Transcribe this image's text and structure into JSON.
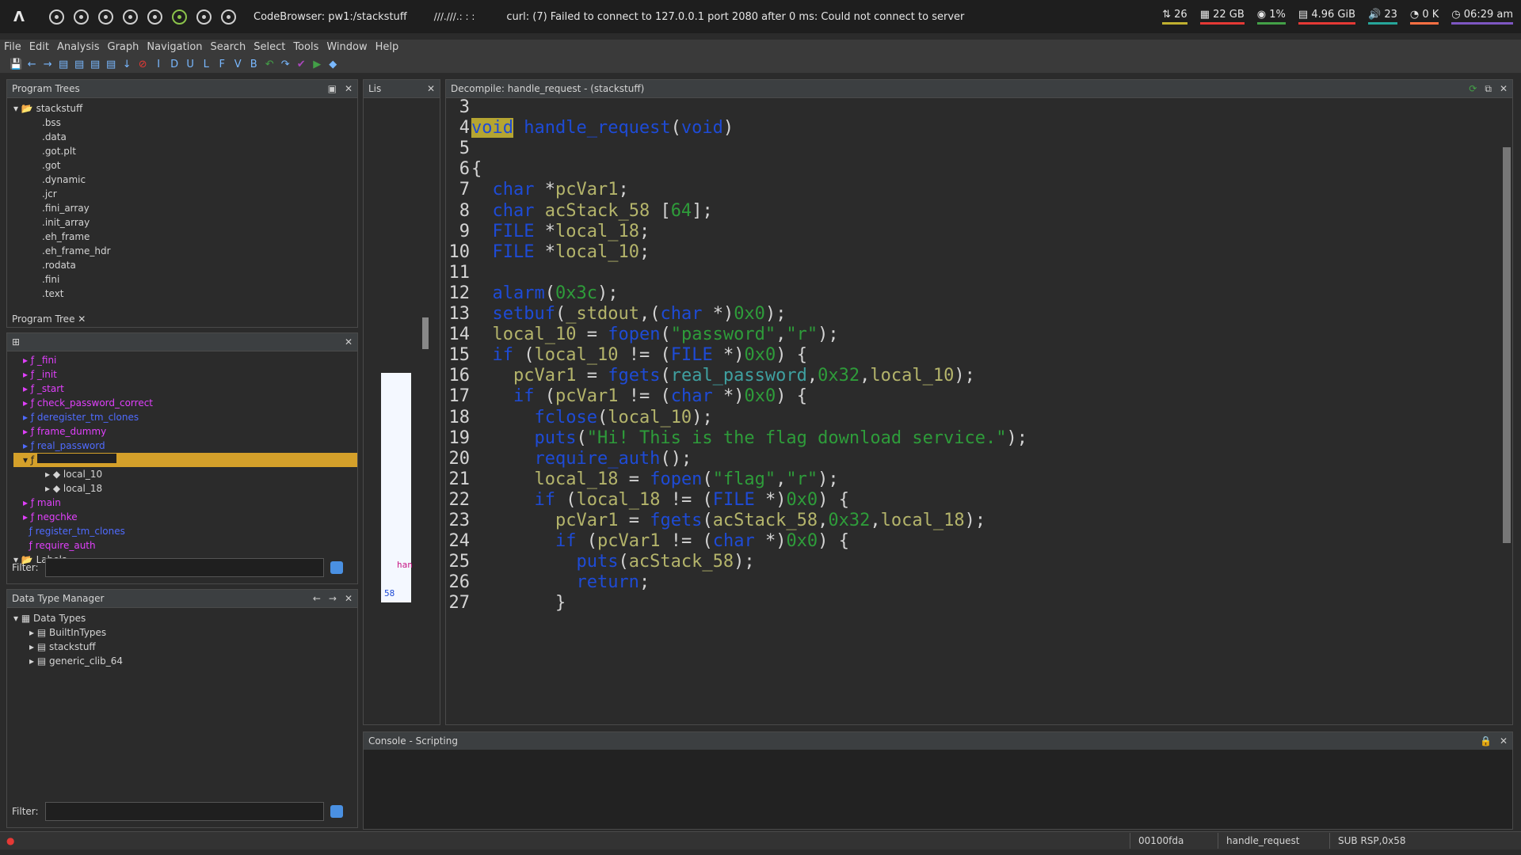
{
  "sysbar": {
    "window_title": "CodeBrowser: pw1:/stackstuff",
    "mid": "///.///.:  : :",
    "message": "curl: (7) Failed to connect to 127.0.0.1 port 2080 after 0 ms: Could not connect to server",
    "stats": [
      "⇅ 26",
      "▦ 22 GB",
      "◉ 1%",
      "▤ 4.96 GiB",
      "🔊 23",
      "◔ 0 K",
      "◷ 06:29 am"
    ]
  },
  "menu": [
    "File",
    "Edit",
    "Analysis",
    "Graph",
    "Navigation",
    "Search",
    "Select",
    "Tools",
    "Window",
    "Help"
  ],
  "program_trees": {
    "title": "Program Trees",
    "root": "stackstuff",
    "items": [
      ".bss",
      ".data",
      ".got.plt",
      ".got",
      ".dynamic",
      ".jcr",
      ".fini_array",
      ".init_array",
      ".eh_frame",
      ".eh_frame_hdr",
      ".rodata",
      ".fini",
      ".text"
    ],
    "tab": "Program Tree"
  },
  "symbol_tree": {
    "functions": [
      "_fini",
      "_init",
      "_start",
      "check_password_correct",
      "deregister_tm_clones",
      "frame_dummy",
      "real_password"
    ],
    "locals": [
      "local_10",
      "local_18"
    ],
    "functions2": [
      "main",
      "negchke",
      "register_tm_clones",
      "require_auth"
    ],
    "labels": "Labels",
    "filter_label": "Filter:"
  },
  "data_type_manager": {
    "title": "Data Type Manager",
    "root": "Data Types",
    "items": [
      "BuiltInTypes",
      "stackstuff",
      "generic_clib_64"
    ],
    "filter_label": "Filter:"
  },
  "listing": {
    "title": "Lis",
    "address": "58",
    "fragment": "han"
  },
  "decompile": {
    "title": "Decompile: handle_request -  (stackstuff)",
    "lines": [
      {
        "n": "3",
        "code": ""
      },
      {
        "n": "4",
        "code": "void handle_request(void)"
      },
      {
        "n": "5",
        "code": ""
      },
      {
        "n": "6",
        "code": "{"
      },
      {
        "n": "7",
        "code": "  char *pcVar1;"
      },
      {
        "n": "8",
        "code": "  char acStack_58 [64];"
      },
      {
        "n": "9",
        "code": "  FILE *local_18;"
      },
      {
        "n": "10",
        "code": "  FILE *local_10;"
      },
      {
        "n": "11",
        "code": ""
      },
      {
        "n": "12",
        "code": "  alarm(0x3c);"
      },
      {
        "n": "13",
        "code": "  setbuf(_stdout,(char *)0x0);"
      },
      {
        "n": "14",
        "code": "  local_10 = fopen(\"password\",\"r\");"
      },
      {
        "n": "15",
        "code": "  if (local_10 != (FILE *)0x0) {"
      },
      {
        "n": "16",
        "code": "    pcVar1 = fgets(real_password,0x32,local_10);"
      },
      {
        "n": "17",
        "code": "    if (pcVar1 != (char *)0x0) {"
      },
      {
        "n": "18",
        "code": "      fclose(local_10);"
      },
      {
        "n": "19",
        "code": "      puts(\"Hi! This is the flag download service.\");"
      },
      {
        "n": "20",
        "code": "      require_auth();"
      },
      {
        "n": "21",
        "code": "      local_18 = fopen(\"flag\",\"r\");"
      },
      {
        "n": "22",
        "code": "      if (local_18 != (FILE *)0x0) {"
      },
      {
        "n": "23",
        "code": "        pcVar1 = fgets(acStack_58,0x32,local_18);"
      },
      {
        "n": "24",
        "code": "        if (pcVar1 != (char *)0x0) {"
      },
      {
        "n": "25",
        "code": "          puts(acStack_58);"
      },
      {
        "n": "26",
        "code": "          return;"
      },
      {
        "n": "27",
        "code": "        }"
      }
    ]
  },
  "console": {
    "title": "Console - Scripting"
  },
  "status": {
    "address": "00100fda",
    "function": "handle_request",
    "instruction": "SUB RSP,0x58"
  }
}
